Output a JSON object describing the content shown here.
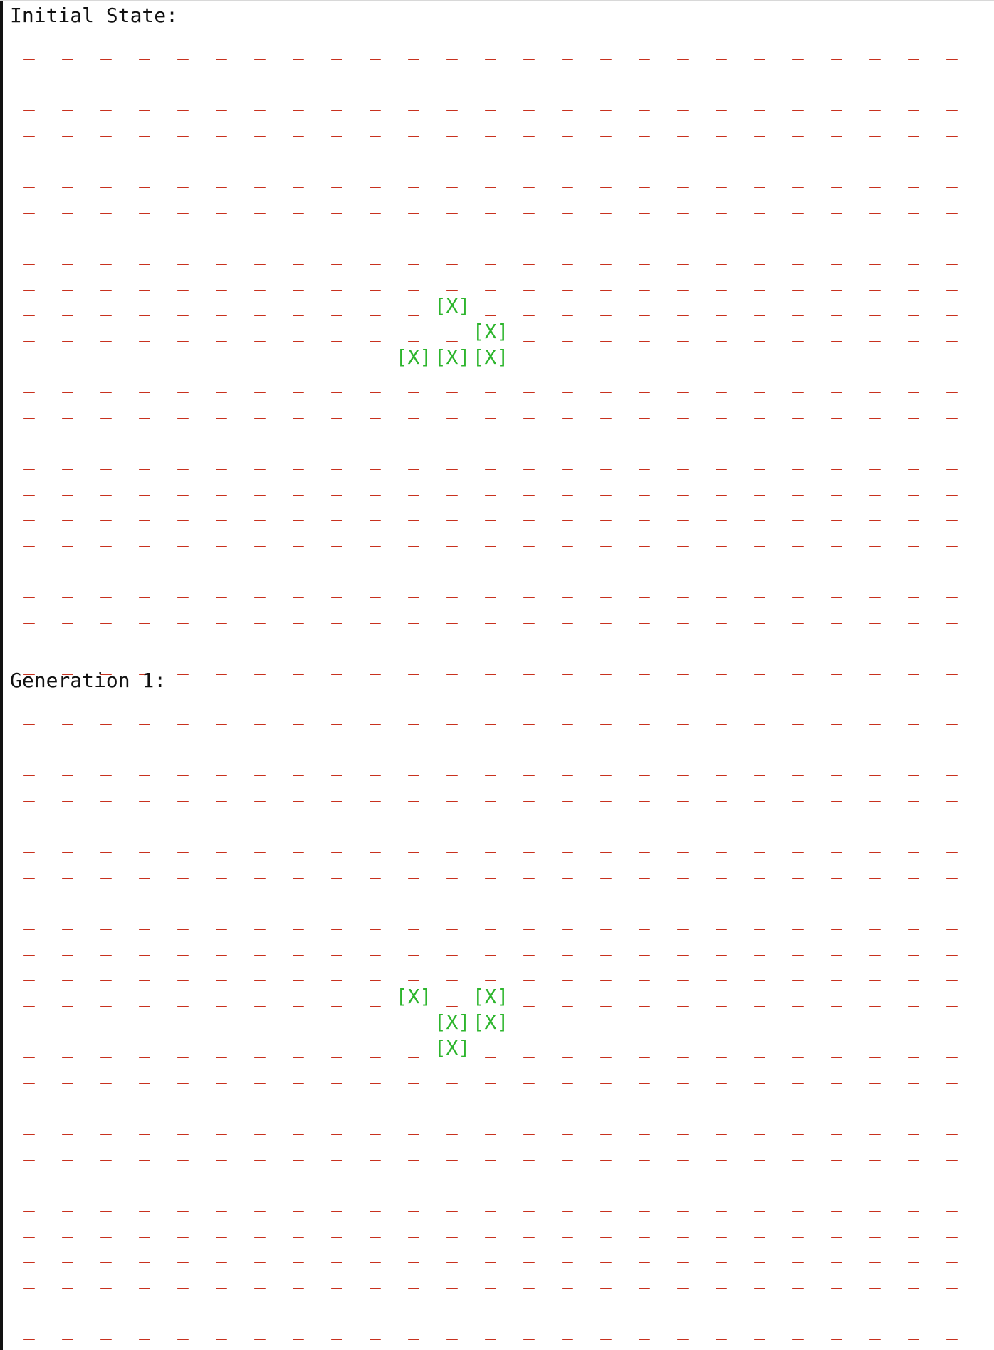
{
  "palette": {
    "dead_cell": "#c8321f",
    "alive_cell": "#2db52d",
    "text": "#111111",
    "background": "#ffffff"
  },
  "symbols": {
    "dead": "_",
    "alive": "[X]"
  },
  "grid": {
    "rows": 25,
    "cols": 25
  },
  "sections": [
    {
      "title": "Initial State:",
      "alive": [
        [
          10,
          11
        ],
        [
          11,
          12
        ],
        [
          12,
          10
        ],
        [
          12,
          11
        ],
        [
          12,
          12
        ]
      ]
    },
    {
      "title": "Generation 1:",
      "alive": [
        [
          11,
          10
        ],
        [
          11,
          12
        ],
        [
          12,
          11
        ],
        [
          12,
          12
        ],
        [
          13,
          11
        ]
      ]
    }
  ]
}
